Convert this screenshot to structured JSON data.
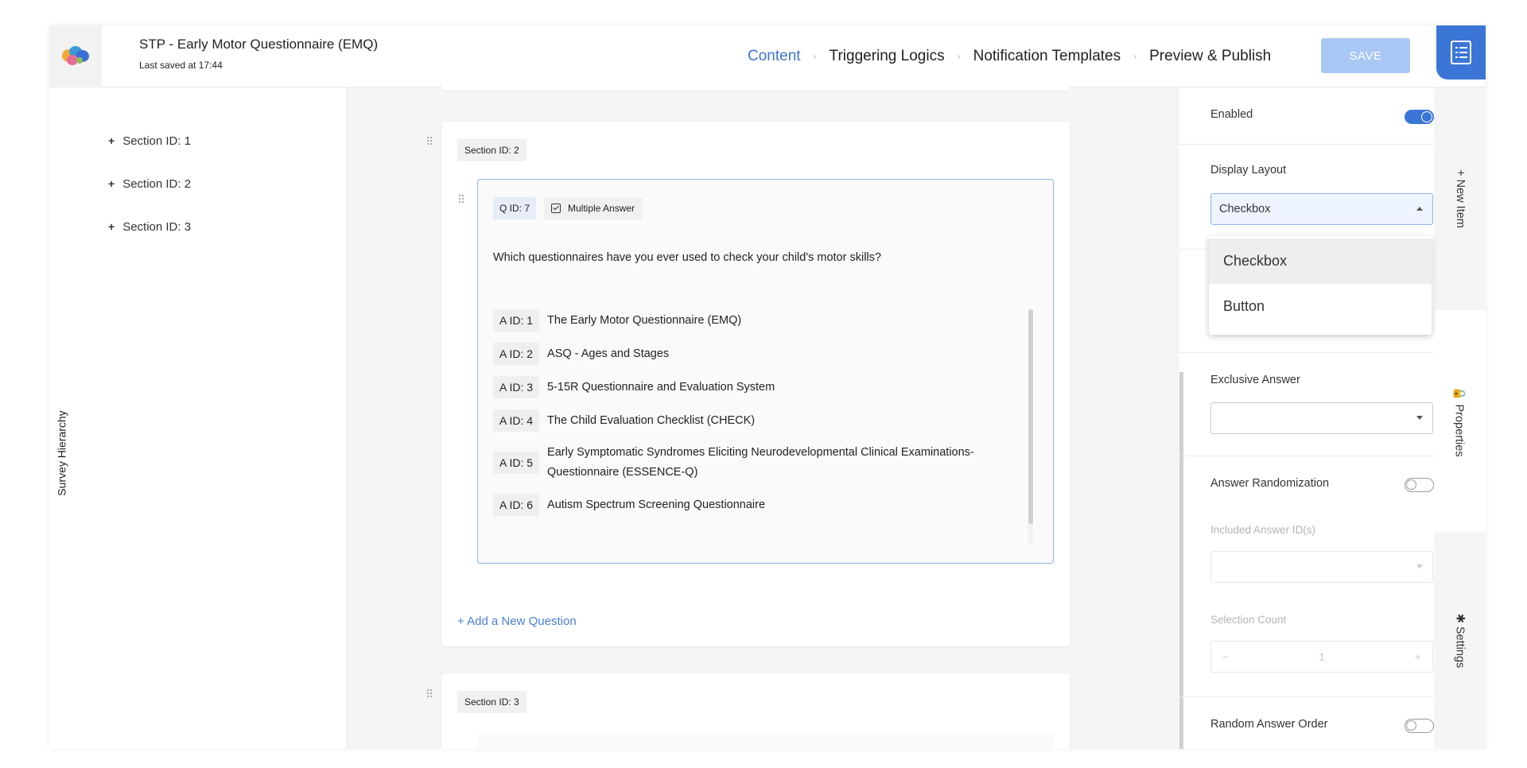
{
  "header": {
    "title": "STP - Early Motor Questionnaire (EMQ)",
    "subtitle": "Last saved at 17:44",
    "nav": [
      {
        "label": "Content",
        "active": true
      },
      {
        "label": "Triggering Logics",
        "active": false
      },
      {
        "label": "Notification Templates",
        "active": false
      },
      {
        "label": "Preview & Publish",
        "active": false
      }
    ],
    "save_label": "SAVE",
    "accent": "#3b76d6"
  },
  "left_panel": {
    "tab_label": "Survey Hierarchy",
    "items": [
      "Section ID: 1",
      "Section ID: 2",
      "Section ID: 3"
    ]
  },
  "canvas": {
    "section2": {
      "tag": "Section ID: 2",
      "question": {
        "id": "Q ID: 7",
        "type": "Multiple Answer",
        "text": "Which questionnaires have you ever used to check your child's motor skills?",
        "answers": [
          {
            "id": "A ID: 1",
            "text": "The Early Motor Questionnaire (EMQ)"
          },
          {
            "id": "A ID: 2",
            "text": "ASQ - Ages and Stages"
          },
          {
            "id": "A ID: 3",
            "text": "5-15R Questionnaire and Evaluation System"
          },
          {
            "id": "A ID: 4",
            "text": "The Child Evaluation Checklist (CHECK)"
          },
          {
            "id": "A ID: 5",
            "text": "Early Symptomatic Syndromes Eliciting Neurodevelopmental Clinical Examinations-Questionnaire (ESSENCE-Q)"
          },
          {
            "id": "A ID: 6",
            "text": "Autism Spectrum Screening Questionnaire"
          }
        ]
      },
      "add_question": "+ Add a New Question"
    },
    "section3": {
      "tag": "Section ID: 3"
    }
  },
  "properties": {
    "enabled_label": "Enabled",
    "display_layout_label": "Display Layout",
    "display_layout_value": "Checkbox",
    "display_layout_options": [
      "Checkbox",
      "Button"
    ],
    "exclusive_answer_label": "Exclusive Answer",
    "answer_randomization_label": "Answer Randomization",
    "included_answer_label": "Included Answer ID(s)",
    "selection_count_label": "Selection Count",
    "selection_count_value": "1",
    "stepper_minus": "−",
    "stepper_plus": "+",
    "random_answer_order_label": "Random Answer Order"
  },
  "side_tabs": {
    "new_item": "+ New Item",
    "properties": "🔒 Properties",
    "settings": "✱ Settings"
  }
}
